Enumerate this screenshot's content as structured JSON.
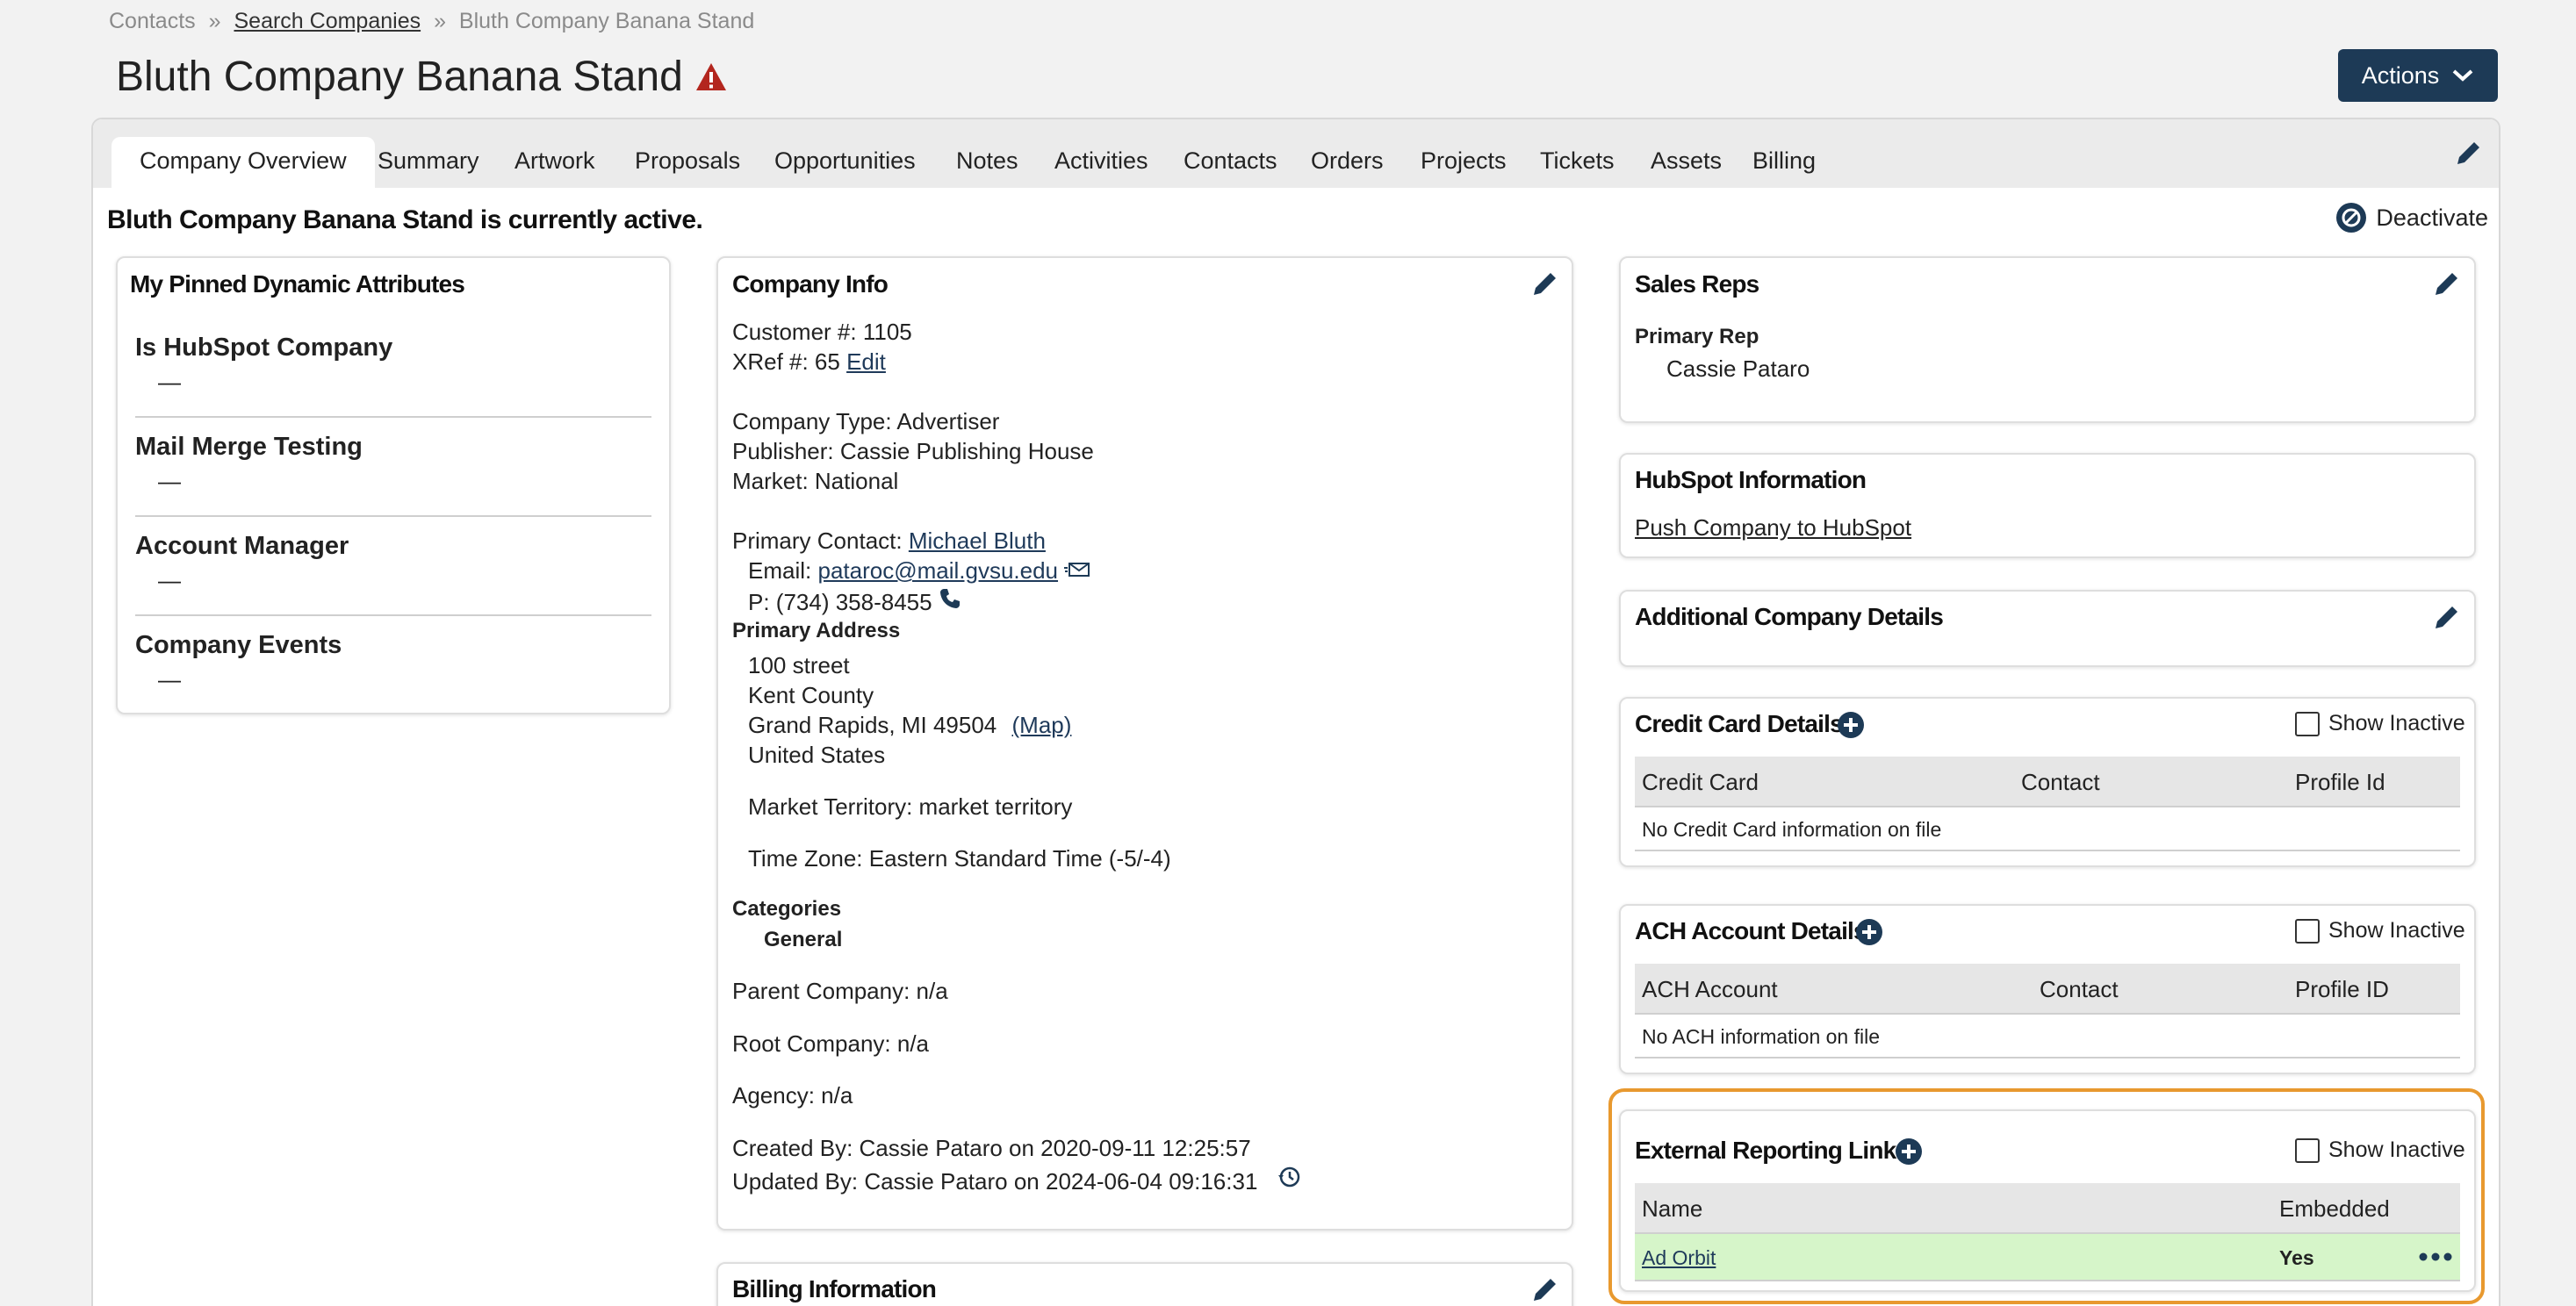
{
  "breadcrumb": {
    "root": "Contacts",
    "link": "Search Companies",
    "current": "Bluth Company Banana Stand",
    "sep": "»"
  },
  "page": {
    "title": "Bluth Company Banana Stand",
    "actions_label": "Actions"
  },
  "tabs": [
    "Company Overview",
    "Summary",
    "Artwork",
    "Proposals",
    "Opportunities",
    "Notes",
    "Activities",
    "Contacts",
    "Orders",
    "Projects",
    "Tickets",
    "Assets",
    "Billing"
  ],
  "status": {
    "text": "Bluth Company Banana Stand is currently active.",
    "deactivate_label": "Deactivate"
  },
  "pinned": {
    "title": "My Pinned Dynamic Attributes",
    "items": [
      {
        "label": "Is HubSpot Company",
        "value": "—"
      },
      {
        "label": "Mail Merge Testing",
        "value": "—"
      },
      {
        "label": "Account Manager",
        "value": "—"
      },
      {
        "label": "Company Events",
        "value": "—"
      }
    ]
  },
  "company_info": {
    "title": "Company Info",
    "customer_no": "Customer #: 1105",
    "xref": "XRef #: 65",
    "xref_edit": "Edit",
    "company_type": "Company Type: Advertiser",
    "publisher": "Publisher: Cassie Publishing House",
    "market": "Market: National",
    "primary_contact_label": "Primary Contact:",
    "primary_contact": "Michael Bluth",
    "email_label": "Email:",
    "email": "pataroc@mail.gvsu.edu",
    "phone": "P: (734) 358-8455",
    "primary_address_label": "Primary Address",
    "address": [
      "100 street",
      "Kent County",
      "Grand Rapids, MI 49504",
      "United States"
    ],
    "map_link": "(Map)",
    "market_territory": "Market Territory: market territory",
    "time_zone": "Time Zone: Eastern Standard Time (-5/-4)",
    "categories_label": "Categories",
    "category": "General",
    "parent_company": "Parent Company: n/a",
    "root_company": "Root Company: n/a",
    "agency": "Agency: n/a",
    "created_by": "Created By: Cassie Pataro on 2020-09-11 12:25:57",
    "updated_by": "Updated By: Cassie Pataro on 2024-06-04 09:16:31"
  },
  "billing": {
    "title": "Billing Information"
  },
  "sales_reps": {
    "title": "Sales Reps",
    "primary_label": "Primary Rep",
    "primary_name": "Cassie Pataro"
  },
  "hubspot": {
    "title": "HubSpot Information",
    "push_link": "Push Company to HubSpot"
  },
  "additional": {
    "title": "Additional Company Details"
  },
  "credit_card": {
    "title": "Credit Card Details",
    "show_inactive": "Show Inactive",
    "columns": [
      "Credit Card",
      "Contact",
      "Profile Id"
    ],
    "empty": "No Credit Card information on file"
  },
  "ach": {
    "title": "ACH Account Details",
    "show_inactive": "Show Inactive",
    "columns": [
      "ACH Account",
      "Contact",
      "Profile ID"
    ],
    "empty": "No ACH information on file"
  },
  "external_links": {
    "title": "External Reporting Links",
    "show_inactive": "Show Inactive",
    "columns": [
      "Name",
      "Embedded"
    ],
    "rows": [
      {
        "name": "Ad Orbit",
        "embedded": "Yes"
      }
    ]
  },
  "colors": {
    "accent": "#1d3a56",
    "highlight": "#e8992f",
    "row_green": "#d6f5c9",
    "warning": "#b3261e"
  }
}
